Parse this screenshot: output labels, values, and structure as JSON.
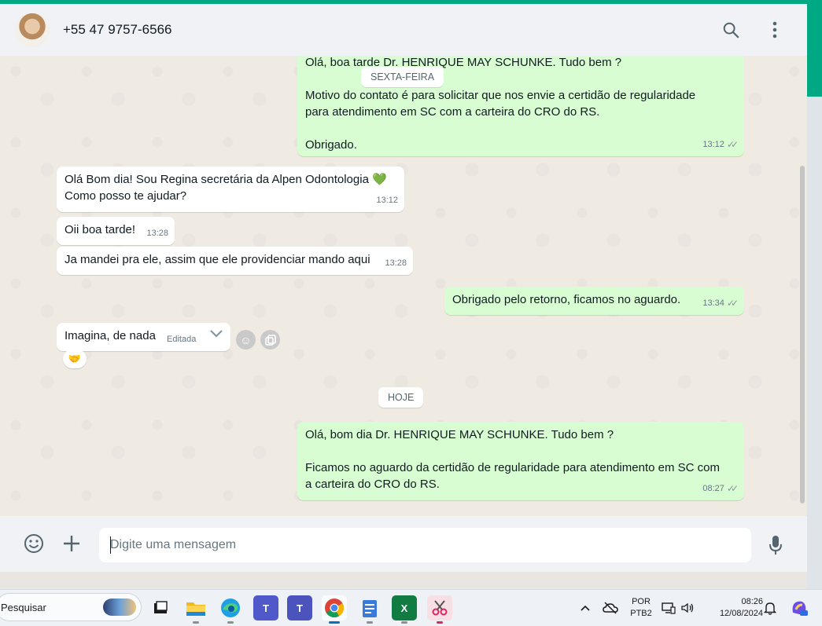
{
  "header": {
    "contact_name": "+55 47 9757-6566",
    "icons": [
      "search-icon",
      "menu-dots-icon"
    ]
  },
  "chat": {
    "date_pills": [
      "SEXTA-FEIRA",
      "HOJE"
    ],
    "messages": [
      {
        "direction": "out",
        "lines": [
          "Olá, boa tarde Dr. HENRIQUE MAY SCHUNKE. Tudo bem ?",
          "Motivo do contato é para solicitar que nos envie a certidão de regularidade",
          "para atendimento em SC com a carteira do CRO do RS.",
          "Obrigado."
        ],
        "time": "13:12"
      },
      {
        "direction": "in",
        "lines": [
          "Olá Bom dia! Sou Regina secretária da Alpen Odontologia",
          "Como posso te ajudar?"
        ],
        "emoji": "💚",
        "time": "13:12"
      },
      {
        "direction": "in",
        "lines": [
          "Oii boa tarde!"
        ],
        "time": "13:28"
      },
      {
        "direction": "in",
        "lines": [
          "Ja mandei pra ele, assim que ele providenciar mando aqui"
        ],
        "time": "13:28"
      },
      {
        "direction": "out",
        "lines": [
          "Obrigado pelo retorno, ficamos no aguardo."
        ],
        "time": "13:34"
      },
      {
        "direction": "in",
        "lines": [
          "Imagina, de nada"
        ],
        "edited_label": "Editada",
        "reaction": "🤝"
      },
      {
        "direction": "out",
        "lines": [
          "Olá, bom dia Dr. HENRIQUE MAY SCHUNKE. Tudo bem ?",
          "Ficamos no aguardo da certidão de regularidade para atendimento em SC com",
          "a carteira do CRO do RS."
        ],
        "time": "08:27"
      }
    ]
  },
  "composer": {
    "placeholder": "Digite uma mensagem",
    "icons": [
      "emoji-icon",
      "plus-icon",
      "microphone-icon"
    ]
  },
  "taskbar": {
    "search_label": "Pesquisar",
    "tray": {
      "language": "POR",
      "layout": "PTB2",
      "time": "08:26",
      "date": "12/08/2024"
    }
  },
  "colors": {
    "accent": "#00a884",
    "outgoing_bubble": "#d9fdd3",
    "incoming_bubble": "#ffffff",
    "chat_background": "#efeae2"
  }
}
